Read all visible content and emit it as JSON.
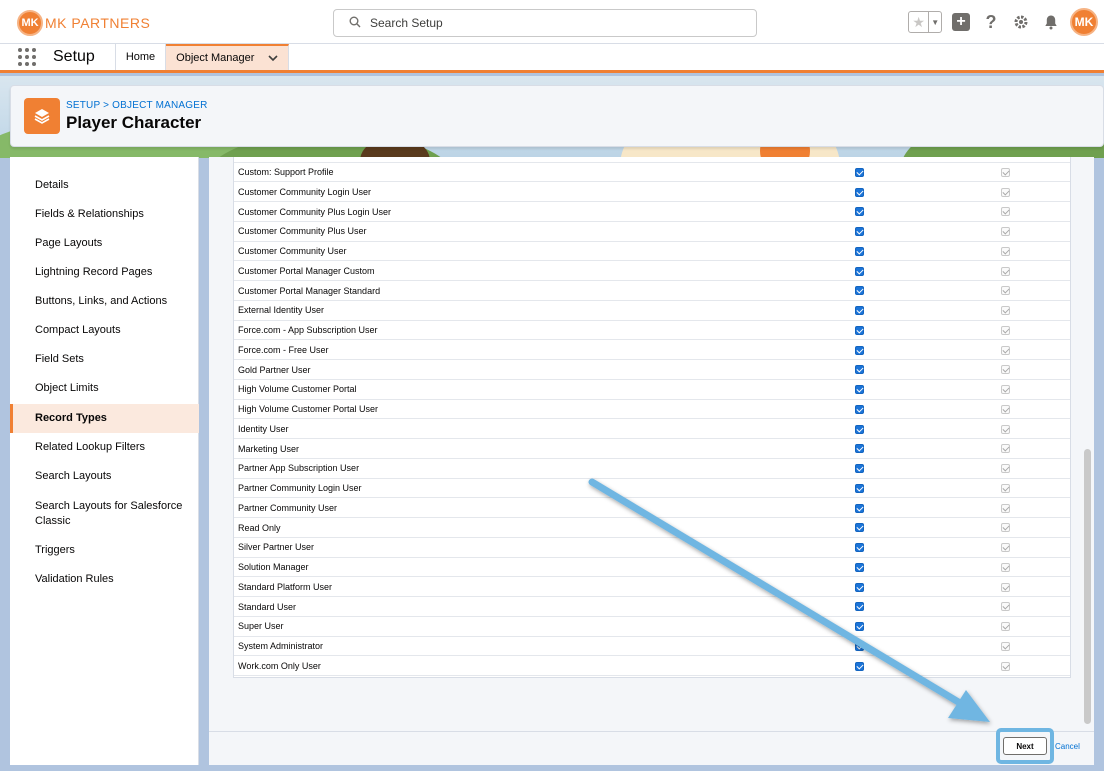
{
  "header": {
    "logo_initials": "MK",
    "logo_text": "MK PARTNERS",
    "search_placeholder": "Search Setup",
    "avatar_initials": "MK"
  },
  "nav": {
    "app_name": "Setup",
    "tabs": [
      {
        "label": "Home"
      },
      {
        "label": "Object Manager"
      }
    ]
  },
  "object_header": {
    "breadcrumb": "SETUP > OBJECT MANAGER",
    "title": "Player Character"
  },
  "sidebar": {
    "items": [
      {
        "label": "Details"
      },
      {
        "label": "Fields & Relationships"
      },
      {
        "label": "Page Layouts"
      },
      {
        "label": "Lightning Record Pages"
      },
      {
        "label": "Buttons, Links, and Actions"
      },
      {
        "label": "Compact Layouts"
      },
      {
        "label": "Field Sets"
      },
      {
        "label": "Object Limits"
      },
      {
        "label": "Record Types"
      },
      {
        "label": "Related Lookup Filters"
      },
      {
        "label": "Search Layouts"
      },
      {
        "label": "Search Layouts for Salesforce Classic"
      },
      {
        "label": "Triggers"
      },
      {
        "label": "Validation Rules"
      }
    ]
  },
  "profiles_table": {
    "rows": [
      {
        "name": "",
        "make_available": true,
        "make_default": true
      },
      {
        "name": "Custom: Support Profile",
        "make_available": true,
        "make_default": true
      },
      {
        "name": "Customer Community Login User",
        "make_available": true,
        "make_default": true
      },
      {
        "name": "Customer Community Plus Login User",
        "make_available": true,
        "make_default": true
      },
      {
        "name": "Customer Community Plus User",
        "make_available": true,
        "make_default": true
      },
      {
        "name": "Customer Community User",
        "make_available": true,
        "make_default": true
      },
      {
        "name": "Customer Portal Manager Custom",
        "make_available": true,
        "make_default": true
      },
      {
        "name": "Customer Portal Manager Standard",
        "make_available": true,
        "make_default": true
      },
      {
        "name": "External Identity User",
        "make_available": true,
        "make_default": true
      },
      {
        "name": "Force.com - App Subscription User",
        "make_available": true,
        "make_default": true
      },
      {
        "name": "Force.com - Free User",
        "make_available": true,
        "make_default": true
      },
      {
        "name": "Gold Partner User",
        "make_available": true,
        "make_default": true
      },
      {
        "name": "High Volume Customer Portal",
        "make_available": true,
        "make_default": true
      },
      {
        "name": "High Volume Customer Portal User",
        "make_available": true,
        "make_default": true
      },
      {
        "name": "Identity User",
        "make_available": true,
        "make_default": true
      },
      {
        "name": "Marketing User",
        "make_available": true,
        "make_default": true
      },
      {
        "name": "Partner App Subscription User",
        "make_available": true,
        "make_default": true
      },
      {
        "name": "Partner Community Login User",
        "make_available": true,
        "make_default": true
      },
      {
        "name": "Partner Community User",
        "make_available": true,
        "make_default": true
      },
      {
        "name": "Read Only",
        "make_available": true,
        "make_default": true
      },
      {
        "name": "Silver Partner User",
        "make_available": true,
        "make_default": true
      },
      {
        "name": "Solution Manager",
        "make_available": true,
        "make_default": true
      },
      {
        "name": "Standard Platform User",
        "make_available": true,
        "make_default": true
      },
      {
        "name": "Standard User",
        "make_available": true,
        "make_default": true
      },
      {
        "name": "Super User",
        "make_available": true,
        "make_default": true
      },
      {
        "name": "System Administrator",
        "make_available": true,
        "make_default": true
      },
      {
        "name": "Work.com Only User",
        "make_available": true,
        "make_default": true
      }
    ]
  },
  "footer": {
    "next_label": "Next",
    "cancel_label": "Cancel"
  },
  "colors": {
    "brand_orange": "#f08033",
    "link_blue": "#0070d2",
    "highlight_blue": "#6fb6e2"
  }
}
